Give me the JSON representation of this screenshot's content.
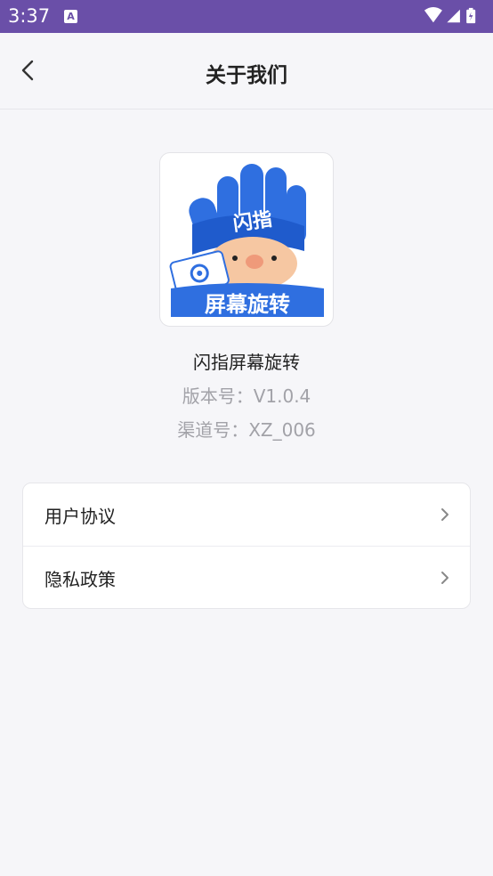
{
  "status_bar": {
    "time": "3:37",
    "notification_icon": "A"
  },
  "header": {
    "title": "关于我们",
    "back_icon": "chevron-left-icon"
  },
  "app": {
    "icon_text_top": "闪指",
    "icon_text_bottom": "屏幕旋转",
    "name": "闪指屏幕旋转",
    "version": "版本号：V1.0.4",
    "channel": "渠道号：XZ_006"
  },
  "menu": {
    "items": [
      {
        "label": "用户协议",
        "icon": "chevron-right-icon"
      },
      {
        "label": "隐私政策",
        "icon": "chevron-right-icon"
      }
    ]
  },
  "colors": {
    "status_bar": "#6a4fa8",
    "background": "#f6f6f9",
    "glove_blue": "#2f6fe0"
  }
}
